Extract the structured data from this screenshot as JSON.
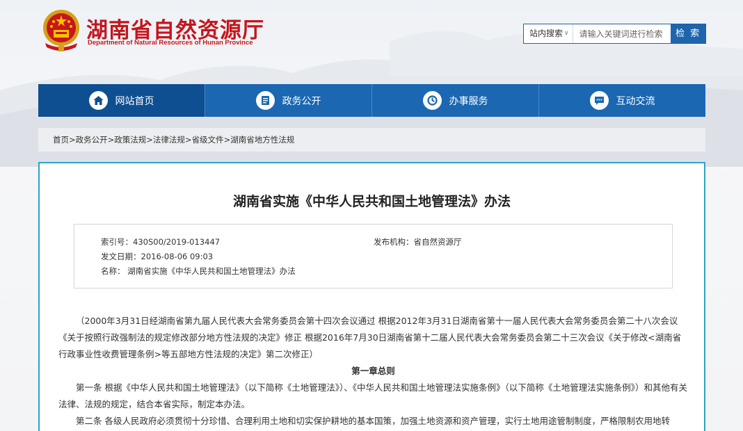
{
  "site": {
    "title": "湖南省自然资源厅",
    "subtitle": "Department of Natural Resources of Hunan Province"
  },
  "search": {
    "scope": "站内搜索",
    "placeholder": "请输入关键词进行检索",
    "button": "检 索"
  },
  "nav": {
    "items": [
      {
        "label": "网站首页",
        "icon": "home-icon"
      },
      {
        "label": "政务公开",
        "icon": "document-icon"
      },
      {
        "label": "办事服务",
        "icon": "service-icon"
      },
      {
        "label": "互动交流",
        "icon": "chat-icon"
      }
    ]
  },
  "breadcrumb": [
    "首页",
    "政务公开",
    "政策法规",
    "法律法规",
    "省级文件",
    "湖南省地方性法规"
  ],
  "document": {
    "title": "湖南省实施《中华人民共和国土地管理法》办法",
    "meta": {
      "index": "索引号：430S00/2019-013447",
      "publisher": "发布机构：省自然资源厅",
      "date": "发文日期：2016-08-06 09:03",
      "name": "名称：  湖南省实施《中华人民共和国土地管理法》办法"
    },
    "preamble": "（2000年3月31日经湖南省第九届人民代表大会常务委员会第十四次会议通过 根据2012年3月31日湖南省第十一届人民代表大会常务委员会第二十八次会议《关于按照行政强制法的规定修改部分地方性法规的决定》修正 根据2016年7月30日湖南省第十二届人民代表大会常务委员会第二十三次会议《关于修改<湖南省行政事业性收费管理条例>等五部地方性法规的决定》第二次修正）",
    "chapter1": "第一章总则",
    "article1": "第一条 根据《中华人民共和国土地管理法》（以下简称《土地管理法》）、《中华人民共和国土地管理法实施条例》（以下简称《土地管理法实施条例》）和其他有关法律、法规的规定，结合本省实际，制定本办法。",
    "article2": "第二条 各级人民政府必须贯彻十分珍惜、合理利用土地和切实保护耕地的基本国策，加强土地资源和资产管理，实行土地用途管制制度，严格限制农用地转"
  },
  "colors": {
    "brand_red": "#c4161c",
    "nav_blue": "#1b67b1",
    "nav_active": "#0e4f92",
    "panel_border": "#2aa3c7"
  }
}
